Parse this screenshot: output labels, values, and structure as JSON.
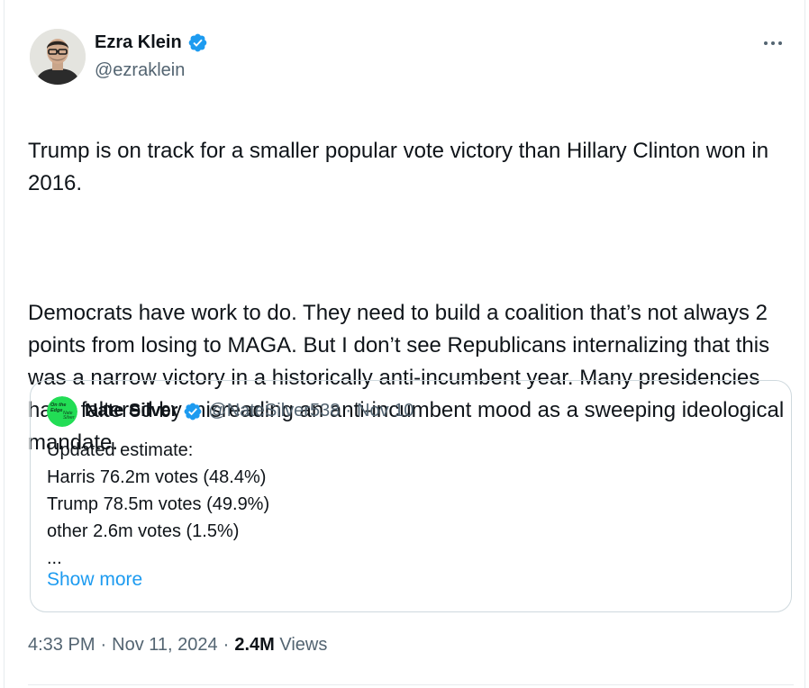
{
  "tweet": {
    "author": {
      "name": "Ezra Klein",
      "handle": "@ezraklein",
      "verified": true
    },
    "menu_icon": "more-horizontal-icon",
    "text_paragraph_1": "Trump is on track for a smaller popular vote victory than Hillary Clinton won in 2016.",
    "text_paragraph_2": "Democrats have work to do. They need to build a coalition that’s not always 2 points from losing to MAGA. But I don’t see Republicans internalizing that this was a narrow victory in a historically anti-incumbent year. Many presidencies have faltered by misreading an anti-incumbent mood as a sweeping ideological mandate.",
    "quoted": {
      "name": "Nate Silver",
      "handle": "@NateSilver538",
      "separator": "·",
      "date": "Nov 10",
      "verified": true,
      "avatar_text": [
        "On the",
        "Edge",
        "Nate",
        "Silver"
      ],
      "lines": [
        "Updated estimate:",
        "Harris 76.2m votes (48.4%)",
        "Trump 78.5m votes (49.9%)",
        "other 2.6m votes (1.5%)",
        "..."
      ],
      "show_more": "Show more"
    },
    "meta": {
      "time": "4:33 PM",
      "sep1": "·",
      "date": "Nov 11, 2024",
      "sep2": "·",
      "views_count": "2.4M",
      "views_label": "Views"
    }
  },
  "colors": {
    "text": "#0f1419",
    "secondary": "#536471",
    "link": "#1d9bf0",
    "border": "#cfd9de",
    "verified": "#1d9bf0",
    "quote_avatar": "#22dd55"
  }
}
